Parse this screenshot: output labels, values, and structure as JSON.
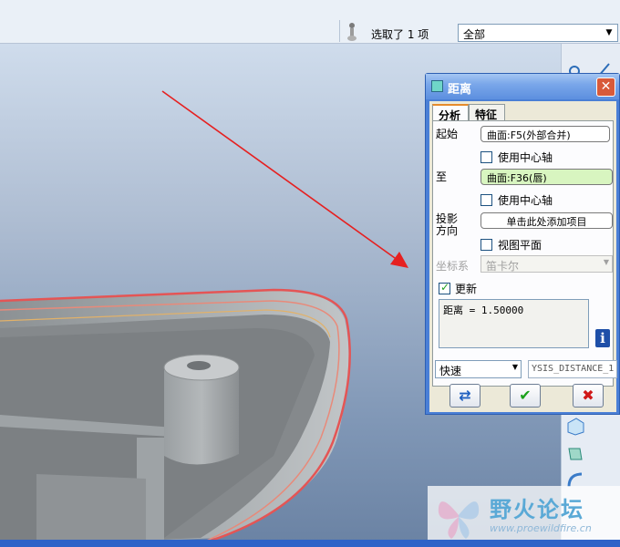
{
  "status_bar": {
    "selection_text": "选取了 1 项",
    "filter_value": "全部"
  },
  "dialog": {
    "title": "距离",
    "tabs": [
      "分析",
      "特征"
    ],
    "from_label": "起始",
    "from_value": "曲面:F5(外部合并)",
    "from_center_axis_label": "使用中心轴",
    "to_label": "至",
    "to_value": "曲面:F36(唇)",
    "to_center_axis_label": "使用中心轴",
    "projection_label_1": "投影",
    "projection_label_2": "方向",
    "projection_button": "单击此处添加项目",
    "view_plane_label": "视图平面",
    "coord_sys_label": "坐标系",
    "coord_sys_value": "笛卡尔",
    "update_label": "更新",
    "update_checked": true,
    "result_text": "距离 = 1.50000",
    "mode_value": "快速",
    "analysis_name": "YSIS_DISTANCE_1"
  },
  "watermark": {
    "title": "野火论坛",
    "url": "www.proewildfire.cn"
  },
  "colors": {
    "accent_blue": "#4a7fd6",
    "arrow_red": "#e62020",
    "selected_green": "#d8f5c0"
  }
}
